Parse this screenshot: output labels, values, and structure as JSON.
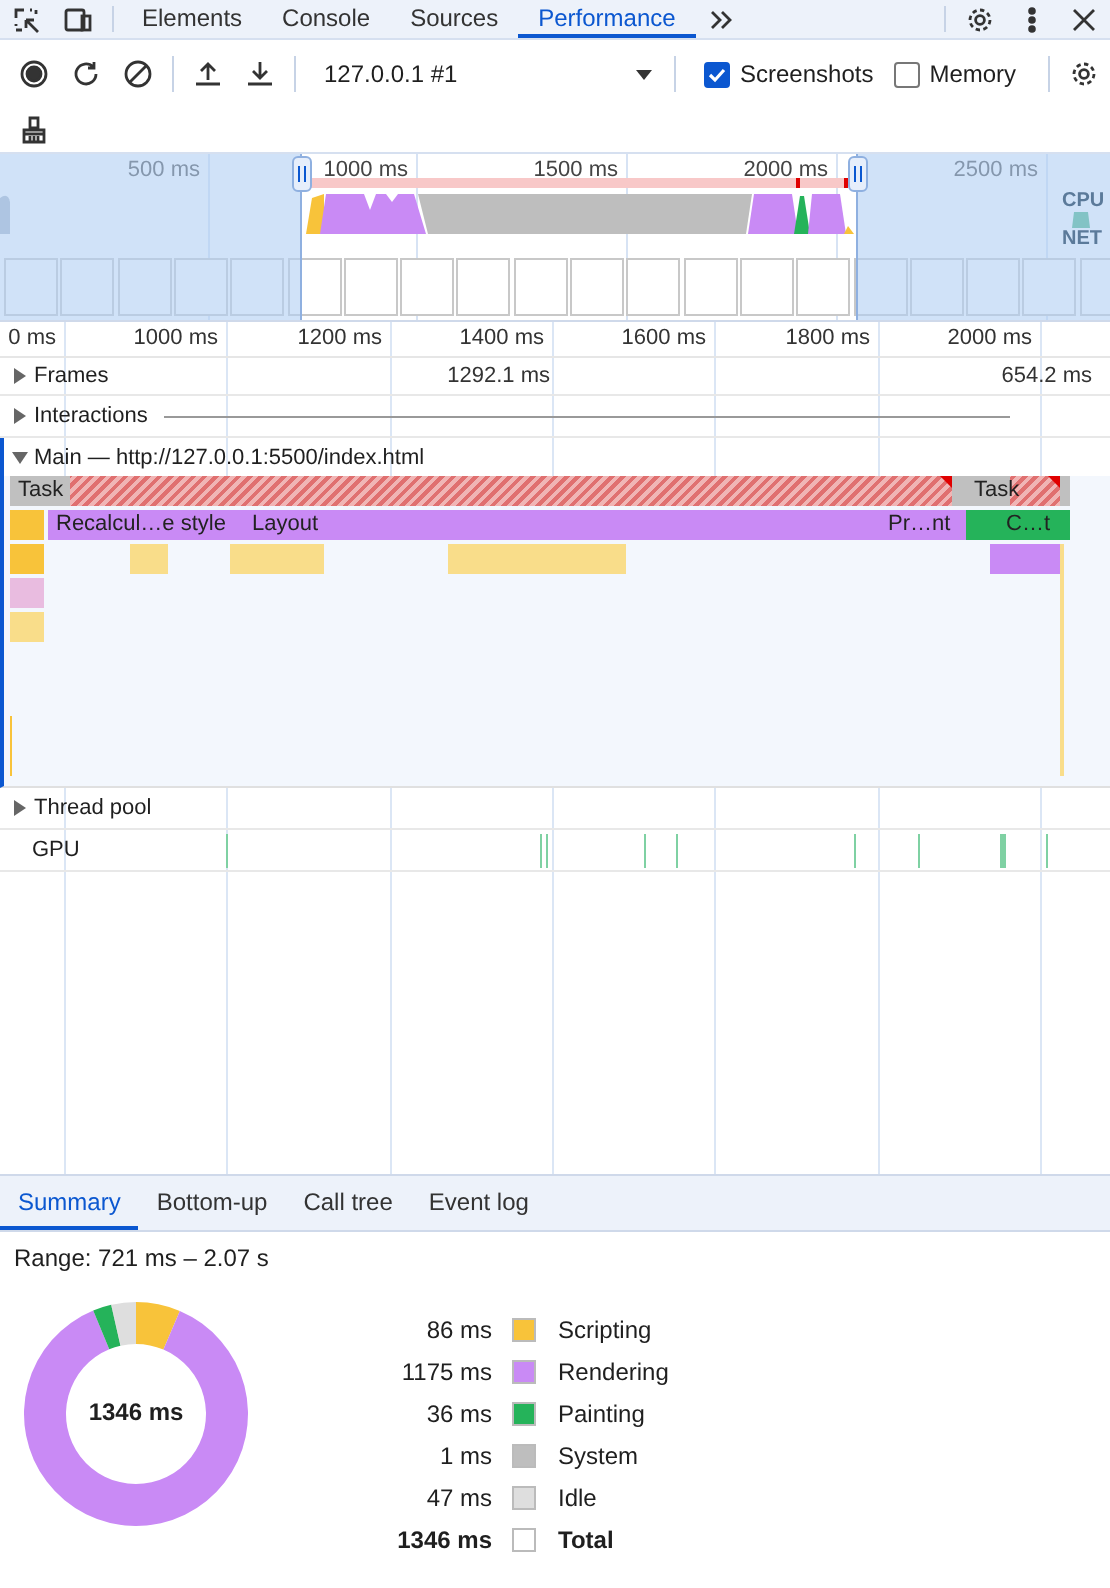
{
  "panel_tabs": [
    {
      "label": "Elements",
      "selected": false
    },
    {
      "label": "Console",
      "selected": false
    },
    {
      "label": "Sources",
      "selected": false
    },
    {
      "label": "Performance",
      "selected": true
    }
  ],
  "recording_toolbar": {
    "recording": "127.0.0.1 #1",
    "checkboxes": [
      {
        "label": "Screenshots",
        "checked": true
      },
      {
        "label": "Memory",
        "checked": false
      }
    ]
  },
  "overview": {
    "ticks": [
      "500 ms",
      "1000 ms",
      "1500 ms",
      "2000 ms",
      "2500 ms"
    ],
    "lanes": [
      "CPU",
      "NET"
    ]
  },
  "ruler": {
    "ticks": [
      "0 ms",
      "1000 ms",
      "1200 ms",
      "1400 ms",
      "1600 ms",
      "1800 ms",
      "2000 ms"
    ]
  },
  "tracks": [
    {
      "label": "Frames",
      "kind": "collapsible",
      "expanded": false,
      "readings": [
        "1292.1 ms",
        "654.2 ms"
      ]
    },
    {
      "label": "Interactions",
      "kind": "collapsible",
      "expanded": false
    }
  ],
  "main": {
    "title": "Main — http://127.0.0.1:5500/index.html",
    "expanded": true,
    "bars": [
      {
        "label": "Task",
        "kind": "task"
      },
      {
        "label": "Task",
        "kind": "task"
      },
      {
        "label": "Recalcul…e style",
        "kind": "rendering"
      },
      {
        "label": "Layout",
        "kind": "rendering"
      },
      {
        "label": "Pr…nt",
        "kind": "rendering"
      },
      {
        "label": "C…t",
        "kind": "painting"
      }
    ]
  },
  "lower_tracks": [
    {
      "label": "Thread pool",
      "kind": "collapsible",
      "expanded": false
    },
    {
      "label": "GPU",
      "kind": "plain"
    }
  ],
  "details_tabs": [
    {
      "label": "Summary",
      "selected": true
    },
    {
      "label": "Bottom-up",
      "selected": false
    },
    {
      "label": "Call tree",
      "selected": false
    },
    {
      "label": "Event log",
      "selected": false
    }
  ],
  "summary": {
    "range": "Range: 721 ms – 2.07 s",
    "center_label": "1346 ms",
    "chart_data": {
      "type": "donut",
      "categories": [
        "Scripting",
        "Rendering",
        "Painting",
        "System",
        "Idle"
      ],
      "values": [
        6.4,
        87.36,
        2.68,
        0.07,
        3.49
      ]
    },
    "legend": [
      {
        "value": "86 ms",
        "color": "#f8c33a"
      },
      {
        "value": "1175 ms",
        "color": "#c98af5"
      },
      {
        "value": "36 ms",
        "color": "#25b35a"
      },
      {
        "value": "1 ms",
        "color": "#bebebe"
      },
      {
        "value": "47 ms",
        "color": "#dedede"
      }
    ],
    "total": {
      "value": "1346 ms",
      "label": "Total",
      "color": "#ffffff"
    }
  }
}
